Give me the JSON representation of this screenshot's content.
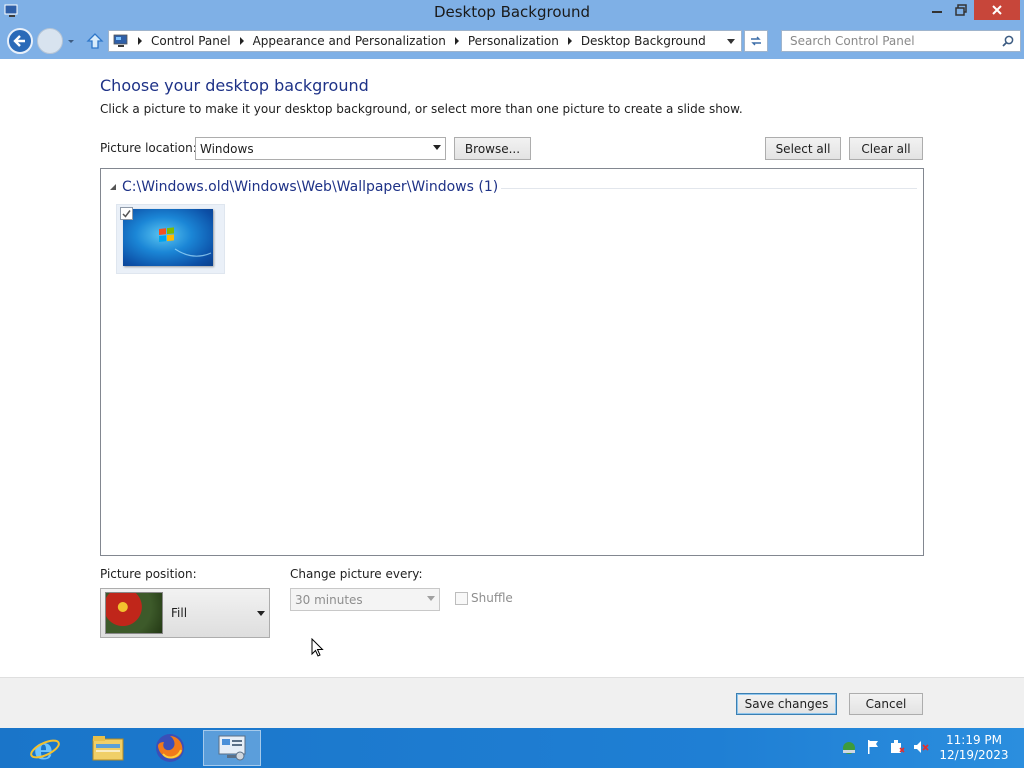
{
  "window": {
    "title": "Desktop Background",
    "buttons": [
      "minimize",
      "restore",
      "close"
    ]
  },
  "nav": {
    "breadcrumbs": [
      "Control Panel",
      "Appearance and Personalization",
      "Personalization",
      "Desktop Background"
    ],
    "search_placeholder": "Search Control Panel"
  },
  "main": {
    "heading": "Choose your desktop background",
    "subtext": "Click a picture to make it your desktop background, or select more than one picture to create a slide show.",
    "picture_location_label": "Picture location:",
    "picture_location_value": "Windows",
    "browse_label": "Browse...",
    "select_all_label": "Select all",
    "clear_all_label": "Clear all",
    "group_title": "C:\\Windows.old\\Windows\\Web\\Wallpaper\\Windows (1)",
    "pictures": [
      {
        "name": "Windows wallpaper",
        "checked": true
      }
    ],
    "picture_position_label": "Picture position:",
    "picture_position_value": "Fill",
    "change_every_label": "Change picture every:",
    "change_every_value": "30 minutes",
    "shuffle_label": "Shuffle",
    "shuffle_checked": false
  },
  "footer": {
    "save_label": "Save changes",
    "cancel_label": "Cancel"
  },
  "taskbar": {
    "apps": [
      "internet-explorer-icon",
      "file-explorer-icon",
      "firefox-icon",
      "control-panel-icon"
    ],
    "active_app": "control-panel-icon",
    "time": "11:19 PM",
    "date": "12/19/2023"
  },
  "colors": {
    "titlebar": "#7fb0e6",
    "heading": "#1e3287",
    "taskbar": "#1f7fd4",
    "close_button": "#c7463a"
  }
}
